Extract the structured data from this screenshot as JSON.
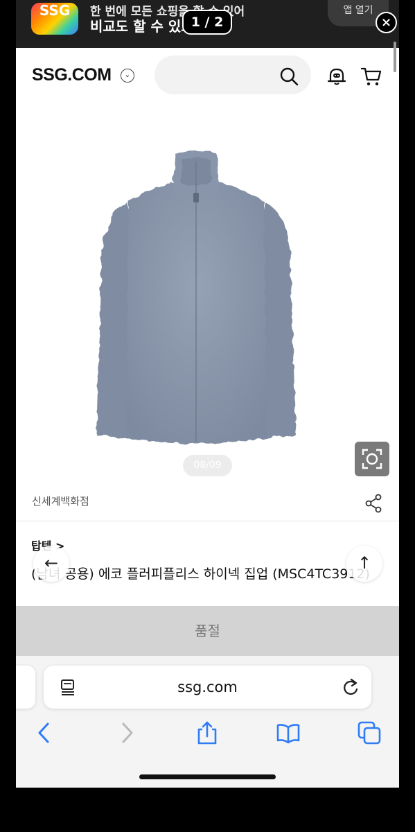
{
  "banner": {
    "logo_text": "SSG",
    "line1": "한 번에 모든 쇼핑을 할 수 있어",
    "line2": "비교도 할 수 있고",
    "cta_label": "앱 열기",
    "pager": "1 / 2",
    "close": "×"
  },
  "header": {
    "logo": "SSG.COM",
    "caret": "⌄",
    "search_icon": "search-icon",
    "bell_icon": "notification-bell-icon",
    "cart_icon": "cart-icon"
  },
  "product": {
    "image_counter": "08/09",
    "store": "신세계백화점",
    "brand": "탑텐 >",
    "title": "(남녀 공용) 에코 플러피플리스 하이넥 집업 (MSC4TC3912)",
    "soldout_label": "품절",
    "colors": {
      "jacket": "#8a97ab",
      "accent": "#111111"
    }
  },
  "nav": {
    "back_arrow": "←",
    "top_arrow": "↑"
  },
  "safari": {
    "url": "ssg.com"
  }
}
